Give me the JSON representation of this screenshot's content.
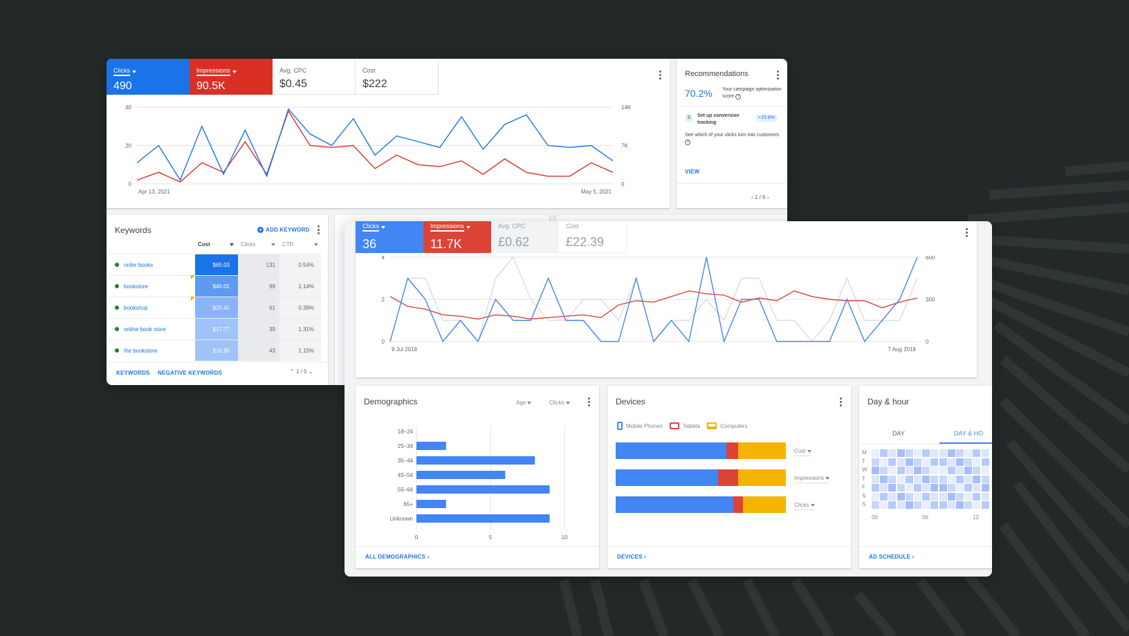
{
  "back": {
    "metrics": [
      {
        "label": "Clicks",
        "value": "490",
        "color": "#1a73e8"
      },
      {
        "label": "Impressions",
        "value": "90.5K",
        "color": "#d93025"
      },
      {
        "label": "Avg. CPC",
        "value": "$0.45"
      },
      {
        "label": "Cost",
        "value": "$222"
      }
    ],
    "chart_data": {
      "type": "line",
      "x_start": "Apr 13, 2021",
      "x_end": "May 5, 2021",
      "y_left_ticks": [
        "40",
        "20",
        "0"
      ],
      "y_right_ticks": [
        "14K",
        "7K",
        "0"
      ],
      "ylim_left": [
        0,
        40
      ],
      "ylim_right": [
        0,
        14000
      ],
      "series": [
        {
          "name": "Clicks",
          "color": "#1a73e8",
          "values": [
            11,
            20,
            2,
            30,
            5,
            28,
            4,
            39,
            26,
            20,
            34,
            15,
            25,
            22,
            19,
            35,
            18,
            31,
            36,
            20,
            19,
            20,
            12
          ]
        },
        {
          "name": "Impressions",
          "color": "#d93025",
          "values": [
            2,
            6,
            1,
            11,
            6,
            22,
            5,
            38,
            20,
            19,
            20,
            8,
            15,
            10,
            9,
            12,
            5,
            13,
            6,
            4,
            4,
            11,
            6
          ]
        }
      ]
    },
    "recommendations": {
      "title": "Recommendations",
      "score": "70.2%",
      "score_caption": "Your campaign optimization score",
      "item_title": "Set up conversion tracking",
      "item_badge": "+15.8%",
      "item_desc": "See which of your clicks turn into customers",
      "view": "VIEW",
      "pager": "1 / 6"
    },
    "keywords": {
      "title": "Keywords",
      "add": "ADD KEYWORD",
      "columns": [
        "Cost",
        "Clicks",
        "CTR"
      ],
      "rows": [
        {
          "name": "order books",
          "cost": "$65.03",
          "clicks": "131",
          "ctr": "0.54%",
          "shade": "#1a73e8"
        },
        {
          "name": "bookstore",
          "cost": "$40.01",
          "clicks": "99",
          "ctr": "1.14%",
          "shade": "#5e9af0"
        },
        {
          "name": "bookshop",
          "cost": "$25.41",
          "clicks": "61",
          "ctr": "0.39%",
          "shade": "#8ab4f8"
        },
        {
          "name": "online book store",
          "cost": "$17.77",
          "clicks": "39",
          "ctr": "1.31%",
          "shade": "#9fc2f9"
        },
        {
          "name": "the bookstore",
          "cost": "$16.90",
          "clicks": "43",
          "ctr": "1.15%",
          "shade": "#9fc2f9"
        }
      ],
      "footer_keywords": "KEYWORDS",
      "footer_negative": "NEGATIVE KEYWORDS",
      "pager": "1 / 5"
    }
  },
  "front": {
    "metrics": [
      {
        "label": "Clicks",
        "value": "36",
        "color": "#4285f4"
      },
      {
        "label": "Impressions",
        "value": "11.7K",
        "color": "#db4437"
      },
      {
        "label": "Avg. CPC",
        "value": "£0.62"
      },
      {
        "label": "Cost",
        "value": "£22.39"
      }
    ],
    "chart_data": {
      "type": "line",
      "x_start": "9 Jul 2018",
      "x_end": "7 Aug 2018",
      "y_left_ticks": [
        "4",
        "2",
        "0"
      ],
      "y_right_ticks": [
        "600",
        "300",
        "0"
      ],
      "ylim_left": [
        0,
        4
      ],
      "ylim_right": [
        0,
        600
      ],
      "series": [
        {
          "name": "Clicks",
          "color": "#4285f4",
          "values": [
            0,
            3,
            2,
            0,
            1,
            0,
            2,
            1,
            1,
            3,
            1,
            1,
            0,
            0,
            3,
            0,
            1,
            0,
            4,
            0,
            2,
            2,
            0,
            0,
            0,
            0,
            2,
            0,
            1,
            2,
            4
          ]
        },
        {
          "name": "Impressions",
          "color": "#db4437",
          "values": [
            320,
            250,
            230,
            190,
            180,
            160,
            190,
            180,
            160,
            170,
            180,
            190,
            170,
            260,
            290,
            280,
            320,
            360,
            340,
            330,
            280,
            310,
            290,
            360,
            320,
            300,
            290,
            290,
            240,
            280,
            310
          ]
        },
        {
          "name": "Previous",
          "color": "#dadce0",
          "values": [
            0,
            3,
            3,
            1,
            1,
            0,
            3,
            4,
            2,
            1,
            1,
            2,
            2,
            1,
            3,
            0,
            1,
            1,
            2,
            1,
            3,
            3,
            1,
            1,
            0,
            1,
            3,
            1,
            1,
            1,
            3
          ]
        }
      ]
    },
    "demographics": {
      "title": "Demographics",
      "filter1": "Age",
      "filter2": "Clicks",
      "chart_data": {
        "type": "bar",
        "categories": [
          "18–24",
          "25–34",
          "35–44",
          "45–54",
          "55–64",
          "65+",
          "Unknown"
        ],
        "values": [
          0,
          2,
          8,
          6,
          9,
          2,
          9
        ],
        "x_ticks": [
          "0",
          "5",
          "10"
        ],
        "xlim": [
          0,
          10
        ],
        "color": "#4285f4"
      },
      "footer": "ALL DEMOGRAPHICS"
    },
    "devices": {
      "title": "Devices",
      "legend": [
        {
          "label": "Mobile Phones",
          "color": "#4285f4"
        },
        {
          "label": "Tablets",
          "color": "#db4437"
        },
        {
          "label": "Computers",
          "color": "#f4b400"
        }
      ],
      "rows": [
        {
          "metric": "Cost",
          "shares": [
            0.65,
            0.07,
            0.28
          ]
        },
        {
          "metric": "Impressions",
          "shares": [
            0.6,
            0.12,
            0.28
          ]
        },
        {
          "metric": "Clicks",
          "shares": [
            0.69,
            0.06,
            0.25
          ]
        }
      ],
      "footer": "DEVICES"
    },
    "dayhour": {
      "title": "Day & hour",
      "tab_day": "DAY",
      "tab_dayhour": "DAY & HO",
      "days": [
        "M",
        "T",
        "W",
        "T",
        "F",
        "S",
        "S"
      ],
      "hours": [
        "00",
        "06",
        "12"
      ],
      "footer": "AD SCHEDULE"
    }
  }
}
